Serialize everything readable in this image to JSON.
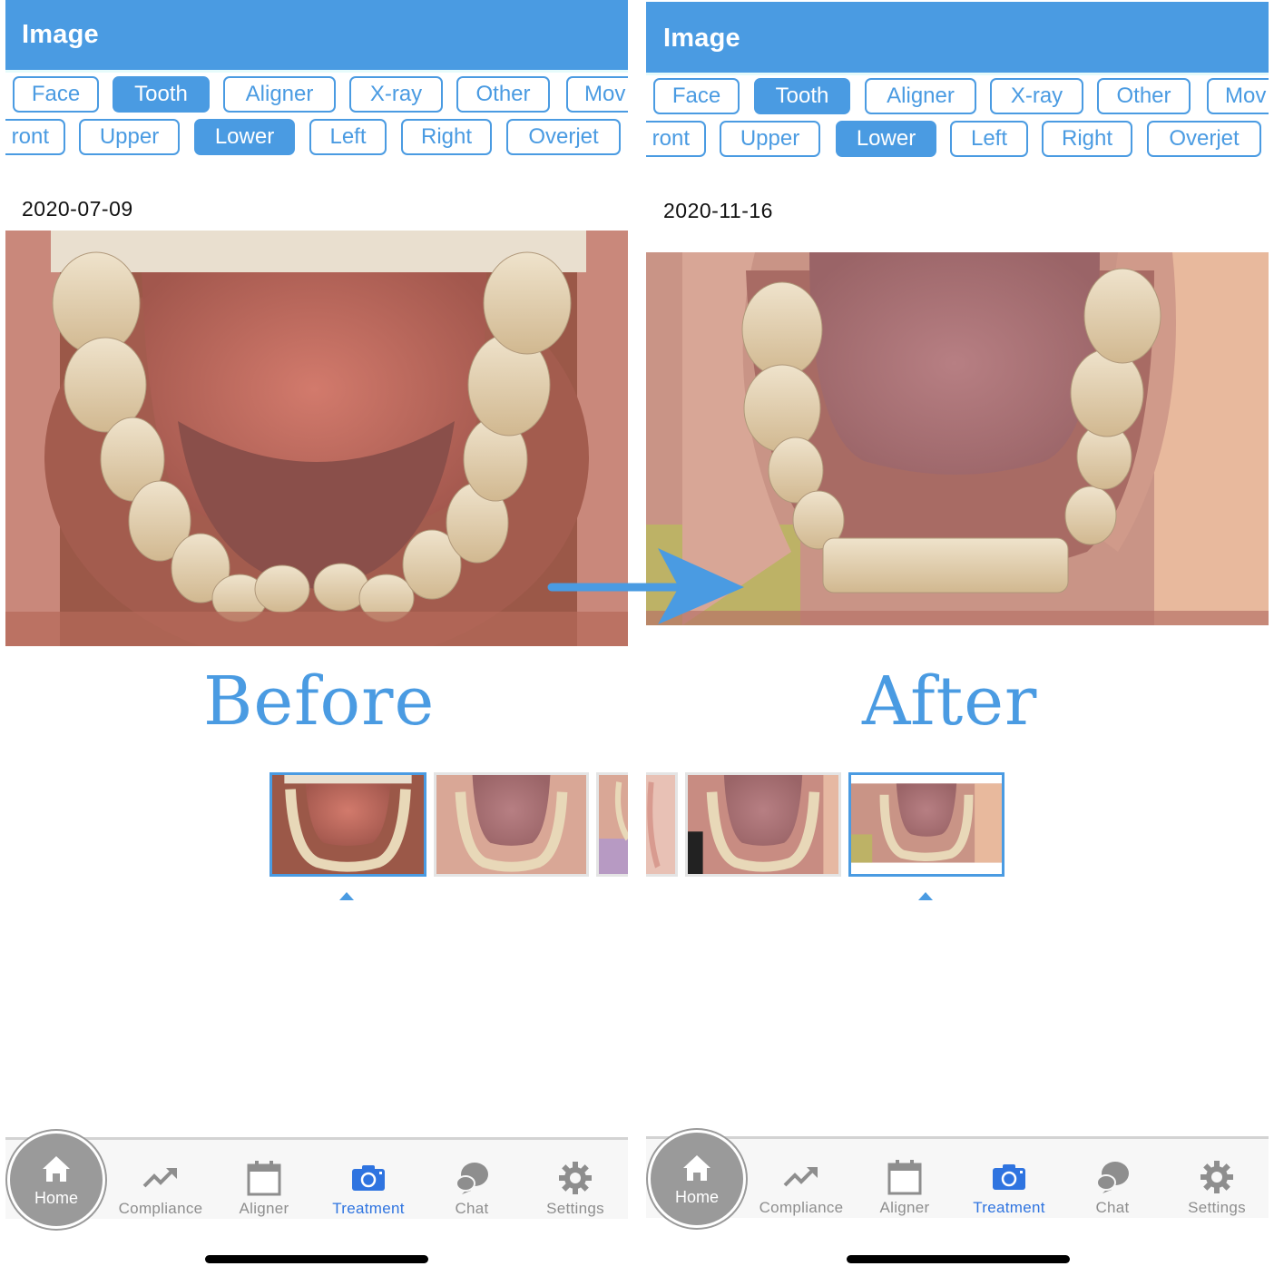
{
  "colors": {
    "accent": "#4a9be2",
    "active_tab": "#2f74e0",
    "inactive_tab": "#8e8e8e"
  },
  "panels": [
    {
      "header": {
        "title": "Image"
      },
      "category_chips": [
        {
          "label": "Face",
          "active": false
        },
        {
          "label": "Tooth",
          "active": true
        },
        {
          "label": "Aligner",
          "active": false
        },
        {
          "label": "X-ray",
          "active": false
        },
        {
          "label": "Other",
          "active": false
        },
        {
          "label": "Mov",
          "active": false
        }
      ],
      "view_chips": [
        {
          "label": "ront",
          "active": false
        },
        {
          "label": "Upper",
          "active": false
        },
        {
          "label": "Lower",
          "active": true
        },
        {
          "label": "Left",
          "active": false
        },
        {
          "label": "Right",
          "active": false
        },
        {
          "label": "Overjet",
          "active": false
        }
      ],
      "date": "2020-07-09",
      "photo_alt": "Lower dental arch photo (before)",
      "caption": "Before"
    },
    {
      "header": {
        "title": "Image"
      },
      "category_chips": [
        {
          "label": "Face",
          "active": false
        },
        {
          "label": "Tooth",
          "active": true
        },
        {
          "label": "Aligner",
          "active": false
        },
        {
          "label": "X-ray",
          "active": false
        },
        {
          "label": "Other",
          "active": false
        },
        {
          "label": "Mov",
          "active": false
        }
      ],
      "view_chips": [
        {
          "label": "ront",
          "active": false
        },
        {
          "label": "Upper",
          "active": false
        },
        {
          "label": "Lower",
          "active": true
        },
        {
          "label": "Left",
          "active": false
        },
        {
          "label": "Right",
          "active": false
        },
        {
          "label": "Overjet",
          "active": false
        }
      ],
      "date": "2020-11-16",
      "photo_alt": "Lower dental arch photo (after)",
      "caption": "After"
    }
  ],
  "tabbar": {
    "items": [
      {
        "label": "Home",
        "icon": "home-icon",
        "active": false
      },
      {
        "label": "Compliance",
        "icon": "trend-up-icon",
        "active": false
      },
      {
        "label": "Aligner",
        "icon": "calendar-icon",
        "active": false
      },
      {
        "label": "Treatment",
        "icon": "camera-icon",
        "active": true
      },
      {
        "label": "Chat",
        "icon": "chat-bubbles-icon",
        "active": false
      },
      {
        "label": "Settings",
        "icon": "gear-icon",
        "active": false
      }
    ]
  }
}
